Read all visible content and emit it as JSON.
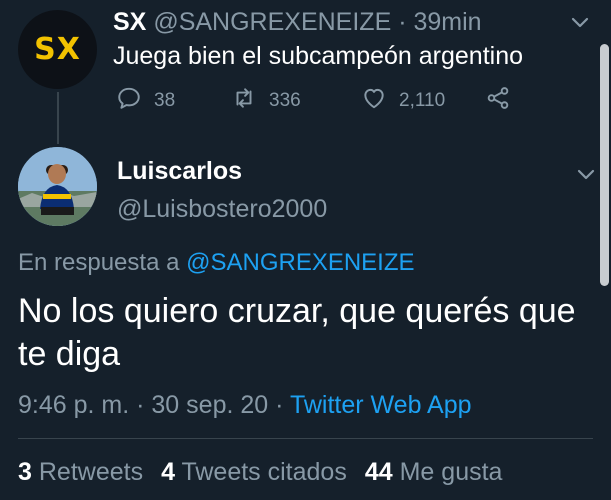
{
  "parent_tweet": {
    "avatar_text": "SX",
    "name": "SX",
    "handle": "@SANGREXENEIZE",
    "separator": "·",
    "time": "39min",
    "text": "Juega bien el subcampeón argentino",
    "replies": "38",
    "retweets": "336",
    "likes": "2,110"
  },
  "tweet": {
    "name": "Luiscarlos",
    "handle": "@Luisbostero2000",
    "reply_label": "En respuesta a",
    "reply_mention": "@SANGREXENEIZE",
    "text": "No los quiero cruzar, que querés que te diga",
    "time": "9:46 p. m.",
    "date": "30 sep. 20",
    "source": "Twitter Web App",
    "sep": "·"
  },
  "stats": {
    "retweets_count": "3",
    "retweets_label": "Retweets",
    "quotes_count": "4",
    "quotes_label": "Tweets citados",
    "likes_count": "44",
    "likes_label": "Me gusta"
  },
  "icons": {
    "reply": "reply-icon",
    "retweet": "retweet-icon",
    "like": "heart-icon",
    "share": "share-icon",
    "menu": "chevron-down-icon"
  },
  "colors": {
    "background": "#15202b",
    "accent": "#1da1f2",
    "secondary_text": "#8899a6",
    "divider": "#38444d",
    "logo_yellow": "#f2c200"
  }
}
